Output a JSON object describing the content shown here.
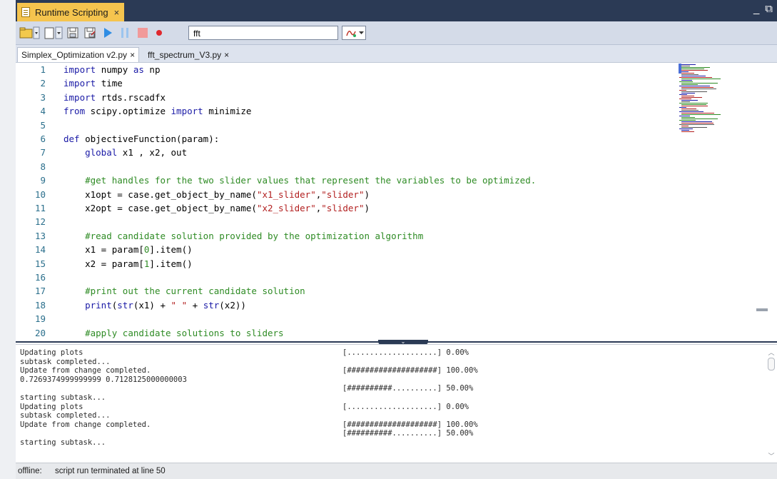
{
  "window": {
    "tab_title": "Runtime Scripting",
    "tab_close": "×",
    "minimize_glyph": "_",
    "popout_glyph": "⧉"
  },
  "toolbar": {
    "search_value": "fft",
    "icons": [
      "open-folder-icon",
      "new-file-icon",
      "save-icon",
      "save-as-icon",
      "run-icon",
      "pause-icon",
      "stop-icon",
      "record-icon",
      "function-select-icon"
    ]
  },
  "file_tabs": [
    {
      "label": "Simplex_Optimization v2.py",
      "close": "×"
    },
    {
      "label": "fft_spectrum_V3.py",
      "close": "×"
    }
  ],
  "code_lines": [
    {
      "n": "1",
      "segs": [
        {
          "t": "import ",
          "c": "kw"
        },
        {
          "t": "numpy ",
          "c": ""
        },
        {
          "t": "as ",
          "c": "kw"
        },
        {
          "t": "np",
          "c": ""
        }
      ]
    },
    {
      "n": "2",
      "segs": [
        {
          "t": "import ",
          "c": "kw"
        },
        {
          "t": "time",
          "c": ""
        }
      ]
    },
    {
      "n": "3",
      "segs": [
        {
          "t": "import ",
          "c": "kw"
        },
        {
          "t": "rtds.rscadfx",
          "c": ""
        }
      ]
    },
    {
      "n": "4",
      "segs": [
        {
          "t": "from ",
          "c": "kw"
        },
        {
          "t": "scipy.optimize ",
          "c": ""
        },
        {
          "t": "import ",
          "c": "kw"
        },
        {
          "t": "minimize",
          "c": ""
        }
      ]
    },
    {
      "n": "5",
      "segs": []
    },
    {
      "n": "6",
      "segs": [
        {
          "t": "def ",
          "c": "kw"
        },
        {
          "t": "objectiveFunction(param):",
          "c": ""
        }
      ]
    },
    {
      "n": "7",
      "segs": [
        {
          "t": "    ",
          "c": ""
        },
        {
          "t": "global ",
          "c": "kw"
        },
        {
          "t": "x1 , x2, out",
          "c": ""
        }
      ]
    },
    {
      "n": "8",
      "segs": []
    },
    {
      "n": "9",
      "segs": [
        {
          "t": "    ",
          "c": ""
        },
        {
          "t": "#get handles for the two slider values that represent the variables to be optimized.",
          "c": "cm"
        }
      ]
    },
    {
      "n": "10",
      "segs": [
        {
          "t": "    x1opt = case.get_object_by_name(",
          "c": ""
        },
        {
          "t": "\"x1_slider\"",
          "c": "st"
        },
        {
          "t": ",",
          "c": ""
        },
        {
          "t": "\"slider\"",
          "c": "st"
        },
        {
          "t": ")",
          "c": ""
        }
      ]
    },
    {
      "n": "11",
      "segs": [
        {
          "t": "    x2opt = case.get_object_by_name(",
          "c": ""
        },
        {
          "t": "\"x2_slider\"",
          "c": "st"
        },
        {
          "t": ",",
          "c": ""
        },
        {
          "t": "\"slider\"",
          "c": "st"
        },
        {
          "t": ")",
          "c": ""
        }
      ]
    },
    {
      "n": "12",
      "segs": []
    },
    {
      "n": "13",
      "segs": [
        {
          "t": "    ",
          "c": ""
        },
        {
          "t": "#read candidate solution provided by the optimization algorithm",
          "c": "cm"
        }
      ]
    },
    {
      "n": "14",
      "segs": [
        {
          "t": "    x1 = param[",
          "c": ""
        },
        {
          "t": "0",
          "c": "cm"
        },
        {
          "t": "].item()",
          "c": ""
        }
      ]
    },
    {
      "n": "15",
      "segs": [
        {
          "t": "    x2 = param[",
          "c": ""
        },
        {
          "t": "1",
          "c": "cm"
        },
        {
          "t": "].item()",
          "c": ""
        }
      ]
    },
    {
      "n": "16",
      "segs": []
    },
    {
      "n": "17",
      "segs": [
        {
          "t": "    ",
          "c": ""
        },
        {
          "t": "#print out the current candidate solution",
          "c": "cm"
        }
      ]
    },
    {
      "n": "18",
      "segs": [
        {
          "t": "    ",
          "c": ""
        },
        {
          "t": "print",
          "c": "kw"
        },
        {
          "t": "(",
          "c": ""
        },
        {
          "t": "str",
          "c": "kw"
        },
        {
          "t": "(x1) + ",
          "c": ""
        },
        {
          "t": "\" \"",
          "c": "st"
        },
        {
          "t": " + ",
          "c": ""
        },
        {
          "t": "str",
          "c": "kw"
        },
        {
          "t": "(x2))",
          "c": ""
        }
      ]
    },
    {
      "n": "19",
      "segs": []
    },
    {
      "n": "20",
      "segs": [
        {
          "t": "    ",
          "c": ""
        },
        {
          "t": "#apply candidate solutions to sliders",
          "c": "cm"
        }
      ]
    }
  ],
  "console": {
    "left": [
      "Updating plots",
      "subtask completed...",
      "Update from change completed.",
      "0.7269374999999999 0.7128125000000003",
      "",
      "starting subtask...",
      "Updating plots",
      "subtask completed...",
      "Update from change completed.",
      "",
      "starting subtask..."
    ],
    "right": [
      "[....................] 0.00%",
      "",
      "[####################] 100.00%",
      "",
      "[##########..........] 50.00%",
      "",
      "[....................] 0.00%",
      "",
      "[####################] 100.00%",
      "[##########..........] 50.00%",
      ""
    ]
  },
  "status": {
    "key": "offline:",
    "message": "script run terminated at line 50"
  }
}
